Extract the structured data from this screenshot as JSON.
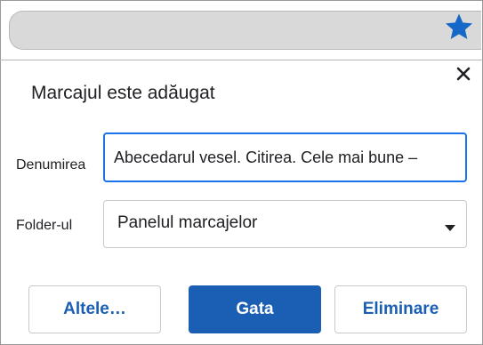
{
  "browser": {
    "bookmark_icon": "star-icon",
    "accent_color": "#1668c8"
  },
  "dialog": {
    "title": "Marcajul este adăugat",
    "close_icon": "close-icon",
    "name_label": "Denumirea",
    "name_value": "Abecedarul vesel. Citirea. Cele mai bune –",
    "folder_label": "Folder-ul",
    "folder_value": "Panelul marcajelor",
    "folder_dropdown_icon": "chevron-down-icon",
    "buttons": {
      "more": "Altele…",
      "done": "Gata",
      "remove": "Eliminare"
    },
    "primary_color": "#1a5fb4"
  }
}
